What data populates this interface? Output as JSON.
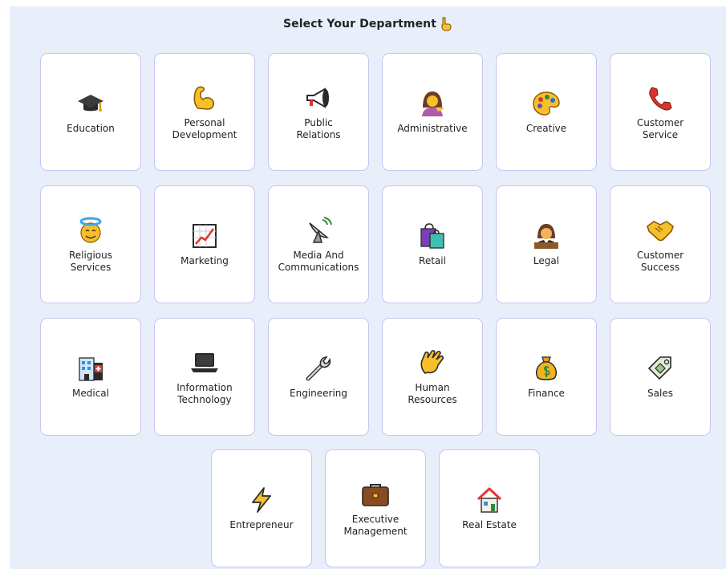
{
  "header": {
    "title": "Select Your Department"
  },
  "departments": [
    {
      "label": "Education",
      "icon": "graduation-cap-icon"
    },
    {
      "label": "Personal\nDevelopment",
      "icon": "flexed-biceps-icon"
    },
    {
      "label": "Public\nRelations",
      "icon": "megaphone-icon"
    },
    {
      "label": "Administrative",
      "icon": "woman-tipping-hand-icon"
    },
    {
      "label": "Creative",
      "icon": "artist-palette-icon"
    },
    {
      "label": "Customer\nService",
      "icon": "telephone-receiver-icon"
    },
    {
      "label": "Religious\nServices",
      "icon": "smiling-face-with-halo-icon"
    },
    {
      "label": "Marketing",
      "icon": "chart-increasing-icon"
    },
    {
      "label": "Media And\nCommunications",
      "icon": "satellite-antenna-icon"
    },
    {
      "label": "Retail",
      "icon": "shopping-bags-icon"
    },
    {
      "label": "Legal",
      "icon": "judge-icon"
    },
    {
      "label": "Customer\nSuccess",
      "icon": "handshake-icon"
    },
    {
      "label": "Medical",
      "icon": "hospital-icon"
    },
    {
      "label": "Information\nTechnology",
      "icon": "laptop-icon"
    },
    {
      "label": "Engineering",
      "icon": "wrench-icon"
    },
    {
      "label": "Human\nResources",
      "icon": "waving-hand-icon"
    },
    {
      "label": "Finance",
      "icon": "money-bag-icon"
    },
    {
      "label": "Sales",
      "icon": "price-tag-icon"
    },
    {
      "label": "Entrepreneur",
      "icon": "high-voltage-icon"
    },
    {
      "label": "Executive\nManagement",
      "icon": "briefcase-icon"
    },
    {
      "label": "Real Estate",
      "icon": "house-icon"
    }
  ]
}
